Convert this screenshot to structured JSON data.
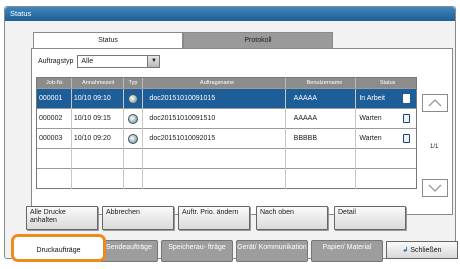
{
  "window": {
    "title": "Status"
  },
  "tabs": [
    {
      "label": "Status",
      "active": true
    },
    {
      "label": "Protokoll",
      "active": false
    }
  ],
  "filter": {
    "label": "Auftragstyp",
    "value": "Alle"
  },
  "table": {
    "columns": [
      "Job-Nr.",
      "Annahmezeit",
      "Typ",
      "Auftragsname",
      "Benutzername",
      "Status"
    ],
    "rows": [
      {
        "nr": "000001",
        "time": "10/10 09:10",
        "name": "doc20151010091015",
        "user": "AAAAA",
        "status": "In Arbeit",
        "selected": true
      },
      {
        "nr": "000002",
        "time": "10/10 09:15",
        "name": "doc20151010091510",
        "user": "AAAAA",
        "status": "Warten",
        "selected": false
      },
      {
        "nr": "000003",
        "time": "10/10 09:20",
        "name": "doc20151010092015",
        "user": "BBBBB",
        "status": "Warten",
        "selected": false
      }
    ]
  },
  "pagination": {
    "text": "1/1"
  },
  "actions": {
    "hold_all": "Alle Drucke anhalten",
    "cancel": "Abbrechen",
    "change_priority": "Auftr. Prio. ändern",
    "move_up": "Nach oben",
    "detail": "Detail"
  },
  "bottom_tabs": [
    {
      "label": "Druckaufträge",
      "active": true
    },
    {
      "label": "Sendeaufträge",
      "active": false
    },
    {
      "label": "Speicherau- fträge",
      "active": false
    },
    {
      "label": "Gerät/ Kommunikation",
      "active": false
    },
    {
      "label": "Papier/ Material",
      "active": false
    }
  ],
  "close_label": "Schließen",
  "colors": {
    "accent": "#1e5e98",
    "highlight": "#f08a1c"
  }
}
